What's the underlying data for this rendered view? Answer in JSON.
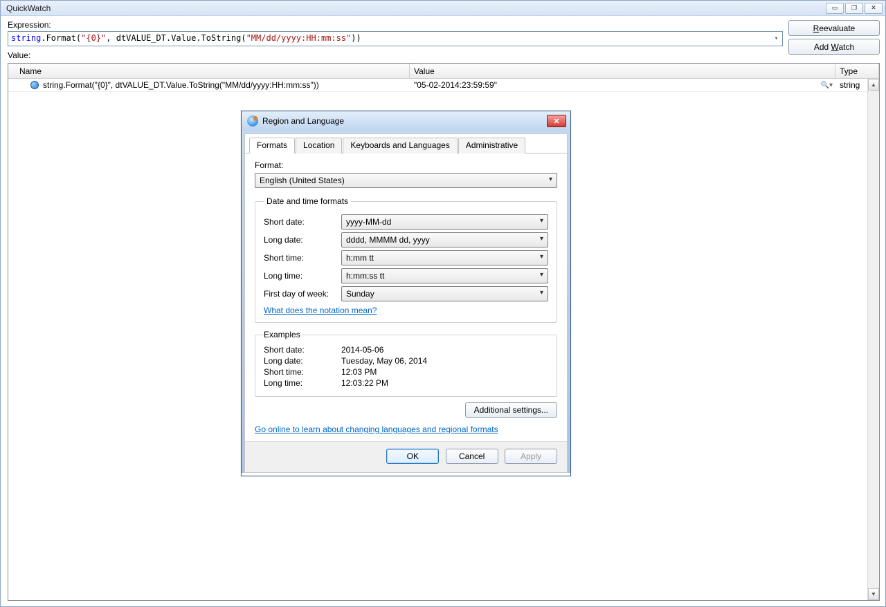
{
  "quickwatch": {
    "title": "QuickWatch",
    "expression_label": "Expression:",
    "expression_kw": "string",
    "expression_mid": ".Format(",
    "expression_str1": "\"{0}\"",
    "expression_mid2": ", dtVALUE_DT.Value.ToString(",
    "expression_str2": "\"MM/dd/yyyy:HH:mm:ss\"",
    "expression_tail": "))",
    "value_label": "Value:",
    "reevaluate": "Reevaluate",
    "addwatch": "Add Watch",
    "columns": {
      "name": "Name",
      "value": "Value",
      "type": "Type"
    },
    "row": {
      "name": "string.Format(\"{0}\", dtVALUE_DT.Value.ToString(\"MM/dd/yyyy:HH:mm:ss\"))",
      "value": "\"05-02-2014:23:59:59\"",
      "type": "string"
    }
  },
  "dialog": {
    "title": "Region and Language",
    "tabs": [
      "Formats",
      "Location",
      "Keyboards and Languages",
      "Administrative"
    ],
    "format_label": "Format:",
    "format_value": "English (United States)",
    "dt_legend": "Date and time formats",
    "short_date_label": "Short date:",
    "short_date_value": "yyyy-MM-dd",
    "long_date_label": "Long date:",
    "long_date_value": "dddd, MMMM dd, yyyy",
    "short_time_label": "Short time:",
    "short_time_value": "h:mm tt",
    "long_time_label": "Long time:",
    "long_time_value": "h:mm:ss tt",
    "first_day_label": "First day of week:",
    "first_day_value": "Sunday",
    "notation_link": "What does the notation mean?",
    "examples_legend": "Examples",
    "ex_short_date_label": "Short date:",
    "ex_short_date_value": "2014-05-06",
    "ex_long_date_label": "Long date:",
    "ex_long_date_value": "Tuesday, May 06, 2014",
    "ex_short_time_label": "Short time:",
    "ex_short_time_value": "12:03 PM",
    "ex_long_time_label": "Long time:",
    "ex_long_time_value": "12:03:22 PM",
    "additional": "Additional settings...",
    "go_online": "Go online to learn about changing languages and regional formats",
    "ok": "OK",
    "cancel": "Cancel",
    "apply": "Apply"
  }
}
